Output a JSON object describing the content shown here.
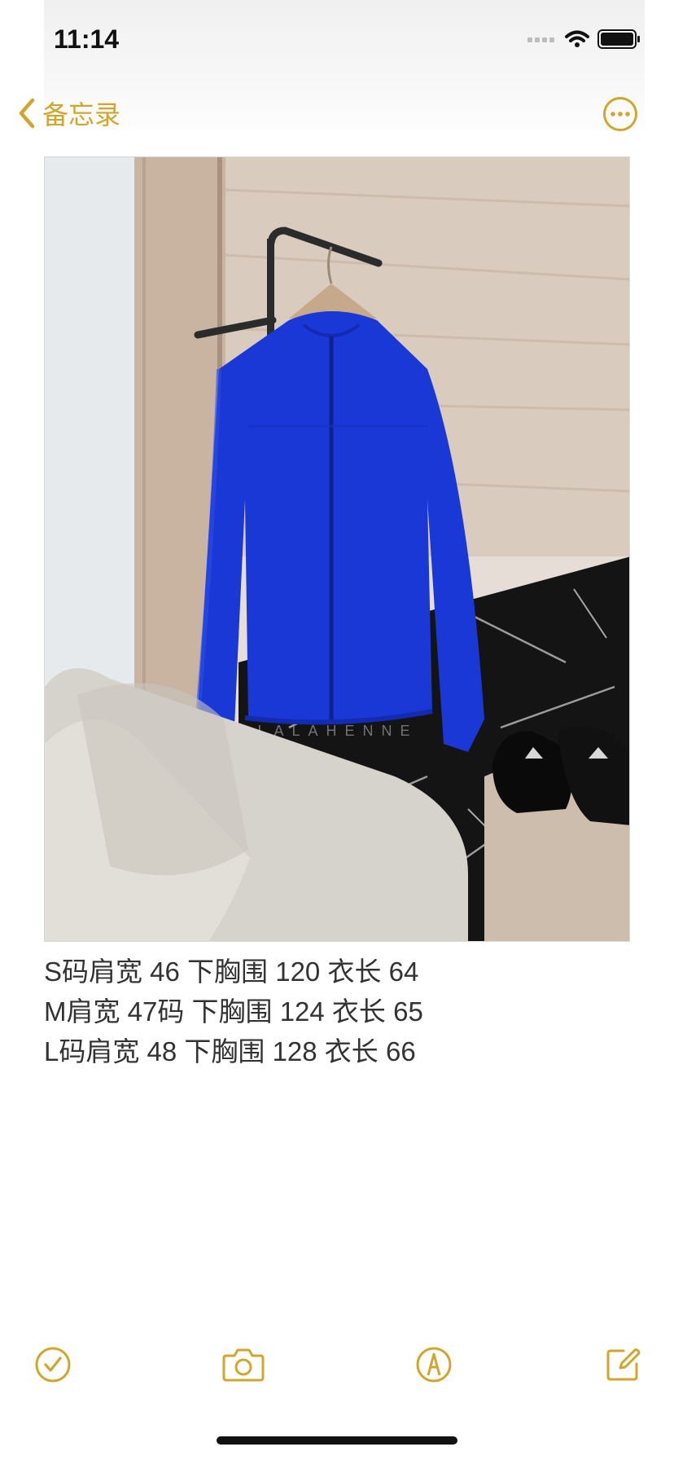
{
  "status_bar": {
    "time": "11:14"
  },
  "nav": {
    "back_label": "备忘录",
    "back_icon": "chevron-left-icon",
    "more_icon": "ellipsis-circle-icon"
  },
  "note": {
    "image_alt": "蓝色连帽拉链外套挂在衣架上",
    "watermark": "LALAHENNE",
    "lines": [
      "S码肩宽 46 下胸围 120 衣长 64",
      "M肩宽 47码 下胸围 124 衣长 65",
      "L码肩宽 48 下胸围 128 衣长 66"
    ]
  },
  "toolbar": {
    "icons": [
      "checklist-icon",
      "camera-icon",
      "markup-icon",
      "compose-icon"
    ]
  },
  "colors": {
    "accent": "#d2a52c",
    "text": "#333333"
  }
}
